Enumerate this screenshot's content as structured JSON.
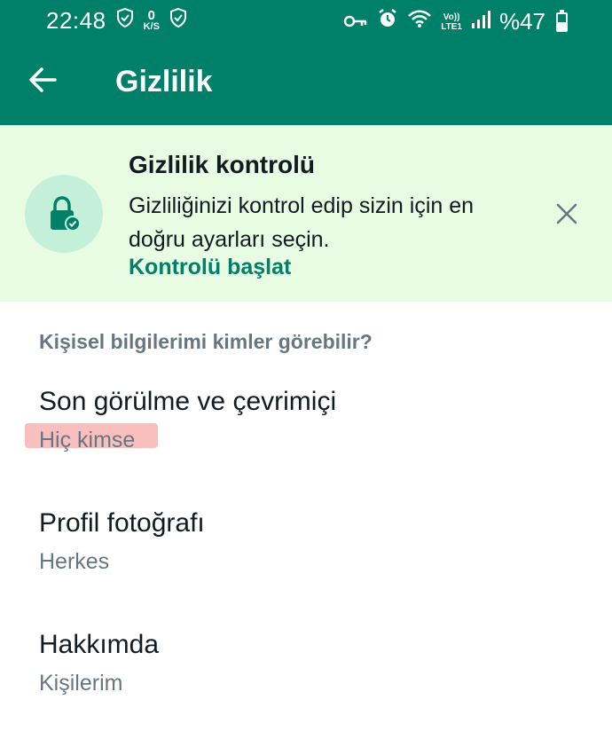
{
  "status_bar": {
    "time": "22:48",
    "speed_value": "0",
    "speed_unit": "K/S",
    "volte_top": "Vo))",
    "volte_bottom": "LTE1",
    "battery": "%47",
    "battery_level_percent": 47
  },
  "app_bar": {
    "title": "Gizlilik",
    "back_icon": "arrow-left-icon"
  },
  "privacy_checkup": {
    "title": "Gizlilik kontrolü",
    "description": "Gizliliğinizi kontrol edip sizin için en doğru ayarları seçin.",
    "link": "Kontrolü başlat",
    "icon": "lock-check-icon",
    "close_icon": "close-icon"
  },
  "section": {
    "header": "Kişisel bilgilerimi kimler görebilir?"
  },
  "settings": [
    {
      "label": "Son görülme ve çevrimiçi",
      "value": "Hiç kimse"
    },
    {
      "label": "Profil fotoğrafı",
      "value": "Herkes"
    },
    {
      "label": "Hakkımda",
      "value": "Kişilerim"
    }
  ],
  "colors": {
    "app_bar": "#008069",
    "banner_bg": "#e7fce3",
    "accent": "#008069",
    "highlight": "#f7a8a8"
  }
}
